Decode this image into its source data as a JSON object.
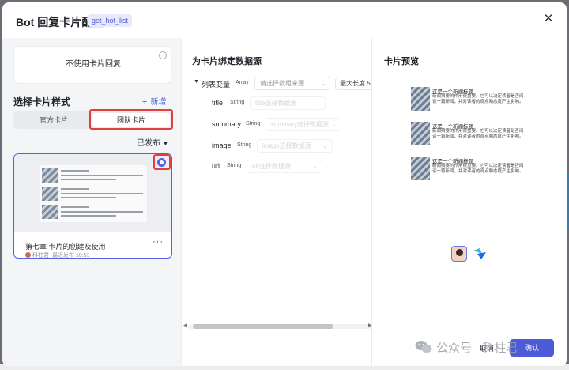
{
  "header": {
    "title": "Bot 回复卡片配置",
    "tag": "get_hot_list",
    "close_icon": "close-icon"
  },
  "left": {
    "no_card_label": "不使用卡片回复",
    "section_title": "选择卡片样式",
    "add_label": "新增",
    "tabs": [
      {
        "label": "官方卡片",
        "selected": false
      },
      {
        "label": "团队卡片",
        "selected": true
      }
    ],
    "publish_filter": "已发布",
    "card": {
      "name": "第七章 卡片的创建及使用",
      "author": "科柱君",
      "published": "最近发布 10:53",
      "selected": true
    }
  },
  "middle": {
    "title": "为卡片绑定数据源",
    "list_var": {
      "name": "列表变量",
      "type": "Array",
      "placeholder": "请选择数组来源",
      "max_len_label": "最大长度",
      "max_len_partial": "5"
    },
    "fields": [
      {
        "name": "title",
        "type": "String",
        "placeholder": "title选择数据源"
      },
      {
        "name": "summary",
        "type": "String",
        "placeholder": "summary选择数据源"
      },
      {
        "name": "image",
        "type": "String",
        "placeholder": "image选择数据源"
      },
      {
        "name": "url",
        "type": "String",
        "placeholder": "url选择数据源"
      }
    ]
  },
  "right": {
    "title": "卡片预览",
    "items": [
      {
        "title": "这是一个新闻标题",
        "desc": "新闻摘要的作用很重要。它可以决定读者是否阅读一篇新闻，并对读者的观点和态度产生影响。"
      },
      {
        "title": "这是一个新闻标题",
        "desc": "新闻摘要的作用很重要。它可以决定读者是否阅读一篇新闻，并对读者的观点和态度产生影响。"
      },
      {
        "title": "这是一个新闻标题",
        "desc": "新闻摘要的作用很重要。它可以决定读者是否阅读一篇新闻，并对读者的观点和态度产生影响。"
      }
    ]
  },
  "footer": {
    "cancel_label": "取消",
    "confirm_label": "确认"
  },
  "watermark": "公众号 · 科柱君",
  "colors": {
    "accent": "#4e5bd8",
    "highlight_red": "#e0403e"
  }
}
